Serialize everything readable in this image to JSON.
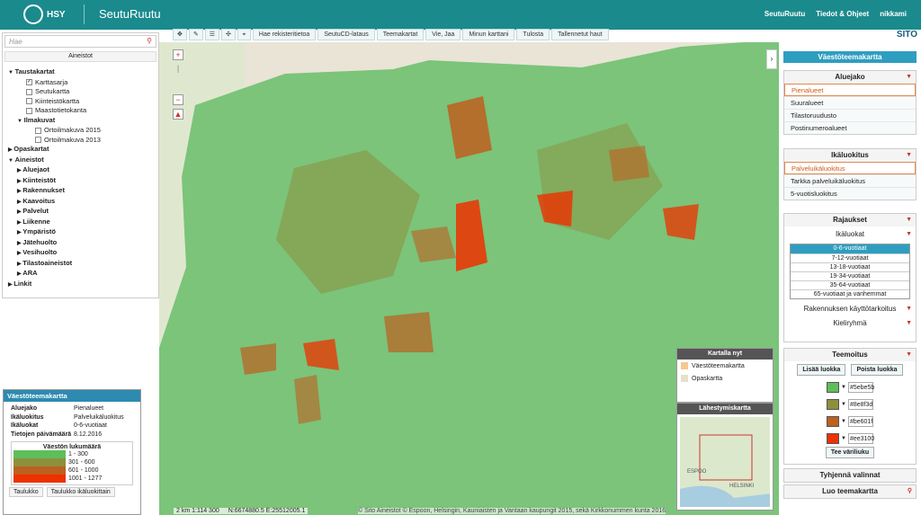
{
  "header": {
    "logo_text": "HSY",
    "app_title": "SeutuRuutu",
    "nav": [
      "SeutuRuutu",
      "Tiedot & Ohjeet",
      "nikkami"
    ]
  },
  "toolbar": {
    "menus": [
      "Hae rekisteritietoa",
      "SeutuCD-lataus",
      "Teemakartat",
      "Vie, Jaa",
      "Minun karttani",
      "Tulosta",
      "Tallennetut haut"
    ]
  },
  "brand": "SITO",
  "left_panel": {
    "search_placeholder": "Hae",
    "section_title": "Aineistot",
    "tree": [
      {
        "label": "Taustakartat",
        "bold": true,
        "level": 0
      },
      {
        "label": "Karttasarja",
        "level": 2,
        "checked": true
      },
      {
        "label": "Seutukartta",
        "level": 2
      },
      {
        "label": "Kiinteistökartta",
        "level": 2
      },
      {
        "label": "Maastotietokanta",
        "level": 2
      },
      {
        "label": "Ilmakuvat",
        "bold": true,
        "level": 1
      },
      {
        "label": "Ortoilmakuva 2015",
        "level": 3
      },
      {
        "label": "Ortoilmakuva 2013",
        "level": 3
      },
      {
        "label": "Opaskartat",
        "bold": true,
        "level": 0
      },
      {
        "label": "Aineistot",
        "bold": true,
        "level": 0
      },
      {
        "label": "Aluejaot",
        "bold": true,
        "level": 1
      },
      {
        "label": "Kiinteistöt",
        "bold": true,
        "level": 1
      },
      {
        "label": "Rakennukset",
        "bold": true,
        "level": 1
      },
      {
        "label": "Kaavoitus",
        "bold": true,
        "level": 1
      },
      {
        "label": "Palvelut",
        "bold": true,
        "level": 1
      },
      {
        "label": "Liikenne",
        "bold": true,
        "level": 1
      },
      {
        "label": "Ympäristö",
        "bold": true,
        "level": 1
      },
      {
        "label": "Jätehuolto",
        "bold": true,
        "level": 1
      },
      {
        "label": "Vesihuolto",
        "bold": true,
        "level": 1
      },
      {
        "label": "Tilastoaineistot",
        "bold": true,
        "level": 1
      },
      {
        "label": "ARA",
        "bold": true,
        "level": 1
      },
      {
        "label": "Linkit",
        "bold": true,
        "level": 0
      }
    ]
  },
  "theme_popup": {
    "title": "Väestöteemakartta",
    "rows": [
      {
        "k": "Aluejako",
        "v": "Pienalueet"
      },
      {
        "k": "Ikäluokitus",
        "v": "Palveluikäluokitus"
      },
      {
        "k": "Ikäluokat",
        "v": "0-6-vuotiaat"
      },
      {
        "k": "Tietojen päivämäärä",
        "v": "8.12.2016"
      }
    ],
    "legend_title": "Väestön lukumäärä",
    "legend": [
      {
        "label": "1 - 300",
        "color": "#5ebe5b"
      },
      {
        "label": "301 - 600",
        "color": "#8e8f3d"
      },
      {
        "label": "601 - 1000",
        "color": "#be601f"
      },
      {
        "label": "1001 - 1277",
        "color": "#ee3100"
      }
    ],
    "btn1": "Taulukko",
    "btn2": "Taulukko ikäluokittain"
  },
  "scale": "2 km 1:114 300",
  "coords": "N:6674880.5 E:25512005.1",
  "attribution": "© Sito Aineistot © Espoon, Helsingin, Kauniaisten ja Vantaan kaupungit 2015, sekä Kirkkonummen kunta 2016",
  "on_map": {
    "title": "Kartalla nyt",
    "items": [
      "Väestöteemakartta",
      "Opaskartta"
    ]
  },
  "overview": {
    "title": "Lähestymiskartta",
    "labels": [
      "ESPOO",
      "HELSINKI"
    ]
  },
  "right_panel": {
    "title": "Väestöteemakartta",
    "aluejako": {
      "head": "Aluejako",
      "options": [
        "Pienalueet",
        "Suuralueet",
        "Tilastoruudusto",
        "Postinumeroalueet"
      ],
      "selected": 0
    },
    "ikaluokitus": {
      "head": "Ikäluokitus",
      "options": [
        "Palveluikäluokitus",
        "Tarkka palveluikäluokitus",
        "5-vuotisluokitus"
      ],
      "selected": 0
    },
    "rajaukset": {
      "head": "Rajaukset",
      "sub": "Ikäluokat",
      "ages": [
        "0-6-vuotiaat",
        "7-12-vuotiaat",
        "13-18-vuotiaat",
        "19-34-vuotiaat",
        "35-64-vuotiaat",
        "65-vuotiaat ja vanhemmat"
      ],
      "selected": 0,
      "more": [
        "Rakennuksen käyttötarkoitus",
        "Kieliryhmä"
      ]
    },
    "teemoitus": {
      "head": "Teemoitus",
      "add": "Lisää luokka",
      "remove": "Poista luokka",
      "colors": [
        "#5ebe5b",
        "#8e8f3d",
        "#be601f",
        "#ee3100"
      ],
      "make_colors": "Tee väriliuku"
    },
    "clear": "Tyhjennä valinnat",
    "create": "Luo teemakartta"
  }
}
